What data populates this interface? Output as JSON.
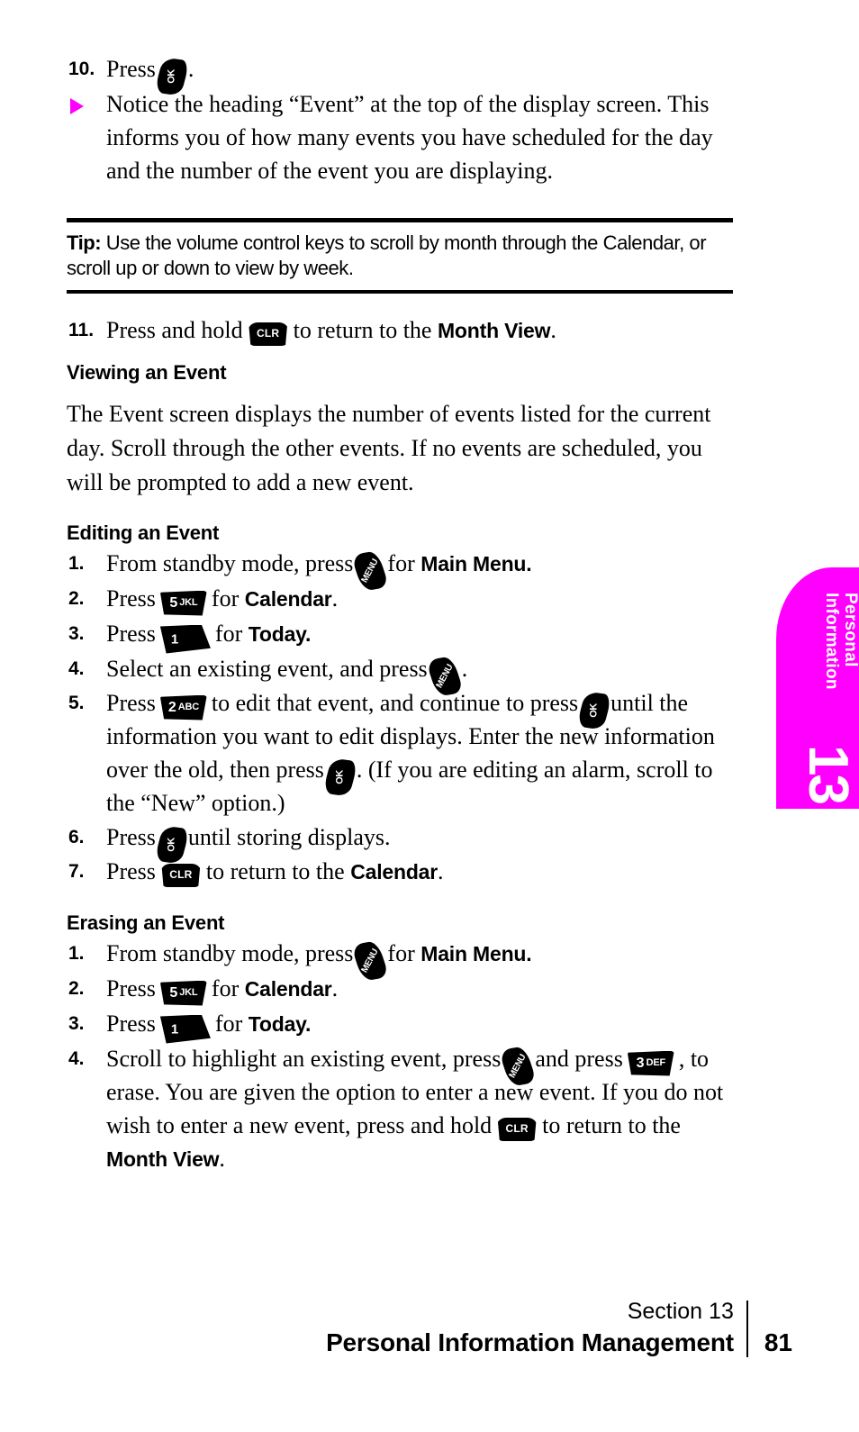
{
  "colors": {
    "accent": "#FF00FF",
    "text": "#000000",
    "background": "#FFFFFF"
  },
  "side_tab": {
    "line1": "Personal",
    "line2": "Information",
    "number": "13"
  },
  "keys": {
    "ok": {
      "label": "OK",
      "name": "ok-key-icon"
    },
    "menu": {
      "label": "MENU",
      "name": "menu-key-icon"
    },
    "clr": {
      "label": "CLR",
      "name": "clr-key-icon"
    },
    "k1": {
      "digit": "1",
      "letters": "",
      "name": "key-1-icon"
    },
    "k2": {
      "digit": "2",
      "letters": "ABC",
      "name": "key-2-abc-icon"
    },
    "k3": {
      "digit": "3",
      "letters": "DEF",
      "name": "key-3-def-icon"
    },
    "k5": {
      "digit": "5",
      "letters": "JKL",
      "name": "key-5-jkl-icon"
    }
  },
  "top_steps": {
    "step10_num": "10.",
    "step10_text_before": "Press",
    "step10_text_after": ".",
    "bullet_text": "Notice the heading “Event” at the top of the display screen. This informs you of how many events you have scheduled for the day and the number of the event you are displaying."
  },
  "tip": {
    "label": "Tip:",
    "text": " Use the volume control keys to scroll by month through the Calendar, or scroll up or down to view by week."
  },
  "step11": {
    "num": "11.",
    "before": "Press and hold",
    "middle": "to return to the",
    "bold": "Month View",
    "after": "."
  },
  "viewing": {
    "heading": "Viewing an Event",
    "paragraph": "The Event screen displays the number of events listed for the current day. Scroll through the other events. If no events are scheduled, you will be prompted to add a new event."
  },
  "editing": {
    "heading": "Editing an Event",
    "steps": [
      {
        "num": "1.",
        "t1": "From standby mode, press",
        "key": "menu",
        "t2": "for",
        "bold": "Main Menu.",
        "t3": ""
      },
      {
        "num": "2.",
        "t1": "Press",
        "key": "k5",
        "t2": "for",
        "bold": "Calendar",
        "t3": "."
      },
      {
        "num": "3.",
        "t1": "Press",
        "key": "k1",
        "t2": "for",
        "bold": "Today.",
        "t3": ""
      },
      {
        "num": "4.",
        "t1": "Select an existing event, and press",
        "key": "menu",
        "t2": "",
        "bold": "",
        "t3": "."
      }
    ],
    "step5": {
      "num": "5.",
      "p1": "Press",
      "p2": "to edit that event, and continue to press",
      "p3": "until the information you want to edit displays. Enter the new information over the old, then press",
      "p4": ". (If you are editing an alarm, scroll to the “New” option.)"
    },
    "step6": {
      "num": "6.",
      "p1": "Press",
      "p2": "until storing displays."
    },
    "step7": {
      "num": "7.",
      "p1": "Press",
      "p2": "to return to the",
      "bold": "Calendar",
      "p3": "."
    }
  },
  "erasing": {
    "heading": "Erasing an Event",
    "steps": [
      {
        "num": "1.",
        "t1": "From standby mode, press",
        "key": "menu",
        "t2": "for",
        "bold": "Main Menu.",
        "t3": ""
      },
      {
        "num": "2.",
        "t1": "Press",
        "key": "k5",
        "t2": "for",
        "bold": "Calendar",
        "t3": "."
      },
      {
        "num": "3.",
        "t1": "Press",
        "key": "k1",
        "t2": "for",
        "bold": "Today.",
        "t3": ""
      }
    ],
    "step4": {
      "num": "4.",
      "p1": "Scroll to highlight an existing event, press",
      "p2": "and press",
      "p3": ", to erase. You are given the option to enter a new event. If you do not wish to enter a new event, press and hold",
      "p4": "to return to the",
      "bold": "Month View",
      "p5": "."
    }
  },
  "footer": {
    "section": "Section 13",
    "title": "Personal Information Management",
    "page": "81"
  }
}
